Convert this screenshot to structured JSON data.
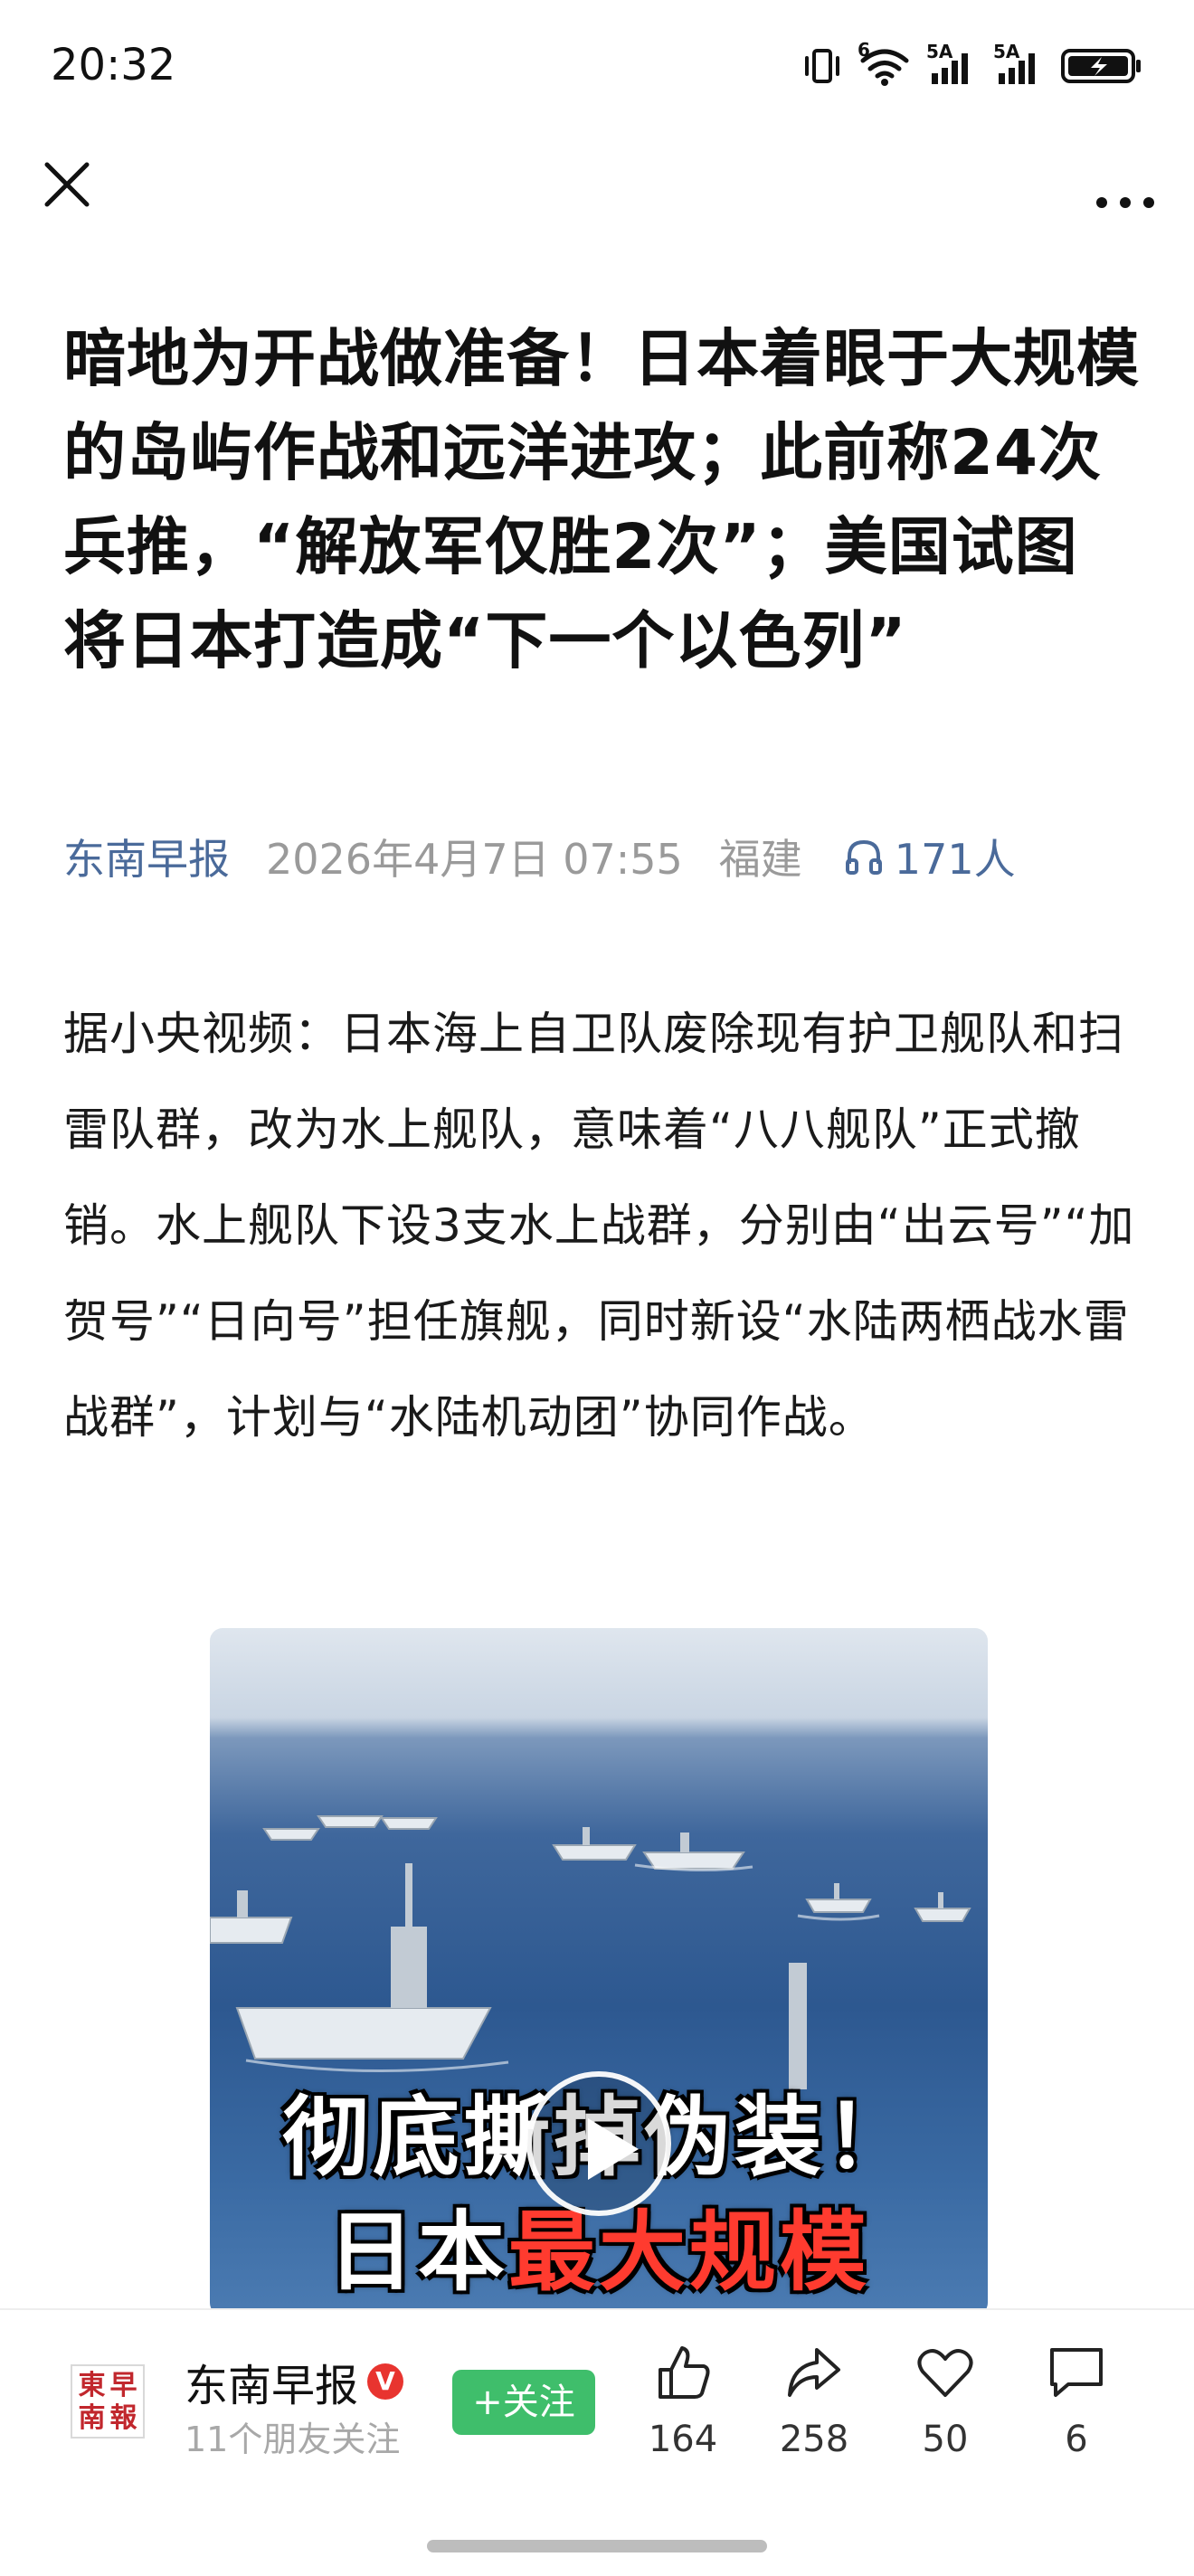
{
  "status_bar": {
    "time": "20:32",
    "network_1": "5A",
    "network_2": "5A",
    "wifi_badge": "6"
  },
  "top_nav": {
    "close_icon": "close-icon",
    "more_icon": "more-horizontal-icon"
  },
  "article": {
    "title": "暗地为开战做准备！日本着眼于大规模的岛屿作战和远洋进攻；此前称24次兵推，“解放军仅胜2次”；美国试图将日本打造成“下一个以色列”",
    "source": "东南早报",
    "date": "2026年4月7日 07:55",
    "location": "福建",
    "listeners": "171人",
    "body": "据小央视频：日本海上自卫队废除现有护卫舰队和扫雷队群，改为水上舰队，意味着“八八舰队”正式撤销。水上舰队下设3支水上战群，分别由“出云号”“加贺号”“日向号”担任旗舰，同时新设“水陆两栖战水雷战群”，计划与“水陆机动团”协同作战。"
  },
  "video": {
    "caption_line1": "彻底撕掉伪装！",
    "caption_line2_plain": "日本",
    "caption_line2_highlight": "最大规模",
    "highlight_color": "#ff3b2f"
  },
  "bottom_bar": {
    "account_name": "东南早报",
    "avatar_text": [
      "東",
      "早",
      "南",
      "報"
    ],
    "verified_mark": "V",
    "friends_follow": "11个朋友关注",
    "follow_label": "+关注",
    "follow_color": "#3fbe6b",
    "like_count": "164",
    "share_count": "258",
    "favorite_count": "50",
    "comment_count": "6"
  },
  "colors": {
    "source_link": "#4a6a9a",
    "meta_gray": "#9a9a9a"
  }
}
